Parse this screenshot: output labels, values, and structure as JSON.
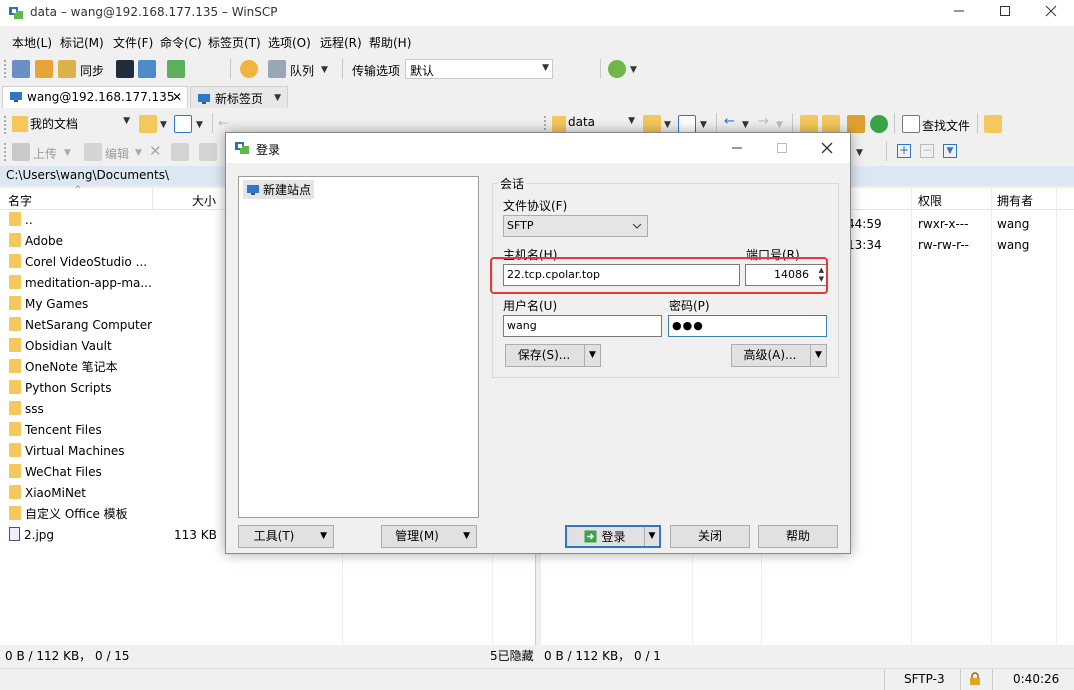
{
  "window": {
    "title": "data – wang@192.168.177.135 – WinSCP"
  },
  "menu": [
    "本地(L)",
    "标记(M)",
    "文件(F)",
    "命令(C)",
    "标签页(T)",
    "选项(O)",
    "远程(R)",
    "帮助(H)"
  ],
  "toolbar": {
    "sync_label": "同步",
    "queue_label": "队列",
    "transfer_options_label": "传输选项",
    "transfer_preset": "默认"
  },
  "tabs": [
    {
      "label": "wang@192.168.177.135"
    },
    {
      "label": "新标签页"
    }
  ],
  "local_panel": {
    "location": "我的文档",
    "upload_label": "上传",
    "edit_label": "编辑",
    "path": "C:\\Users\\wang\\Documents\\",
    "columns": {
      "name": "名字",
      "size": "大小"
    },
    "files": [
      {
        "name": "..",
        "size": "",
        "type": "parent"
      },
      {
        "name": "Adobe",
        "size": "",
        "type": "folder"
      },
      {
        "name": "Corel VideoStudio ...",
        "size": "",
        "type": "folder"
      },
      {
        "name": "meditation-app-ma...",
        "size": "",
        "type": "folder"
      },
      {
        "name": "My Games",
        "size": "",
        "type": "folder"
      },
      {
        "name": "NetSarang Computer",
        "size": "",
        "type": "folder"
      },
      {
        "name": "Obsidian Vault",
        "size": "",
        "type": "folder"
      },
      {
        "name": "OneNote 笔记本",
        "size": "",
        "type": "folder"
      },
      {
        "name": "Python Scripts",
        "size": "",
        "type": "folder"
      },
      {
        "name": "sss",
        "size": "",
        "type": "folder"
      },
      {
        "name": "Tencent Files",
        "size": "",
        "type": "folder"
      },
      {
        "name": "Virtual Machines",
        "size": "",
        "type": "folder"
      },
      {
        "name": "WeChat Files",
        "size": "",
        "type": "folder"
      },
      {
        "name": "XiaoMiNet",
        "size": "",
        "type": "folder"
      },
      {
        "name": "自定义 Office 模板",
        "size": "",
        "type": "folder"
      },
      {
        "name": "2.jpg",
        "size": "113 KB",
        "type": "file"
      }
    ],
    "status": "0 B / 112 KB，  0 / 15",
    "hidden": "5已隐藏"
  },
  "remote_panel": {
    "location": "data",
    "find_files_label": "查找文件",
    "columns": {
      "permissions": "权限",
      "owner": "拥有者"
    },
    "rows": [
      {
        "time": "44:59",
        "permissions": "rwxr-x---",
        "owner": "wang"
      },
      {
        "time": "13:34",
        "permissions": "rw-rw-r--",
        "owner": "wang"
      }
    ],
    "status": "0 B / 112 KB，  0 / 1"
  },
  "bottom_bar": {
    "protocol": "SFTP-3",
    "elapsed": "0:40:26"
  },
  "dialog": {
    "title": "登录",
    "site_tree": {
      "new_site": "新建站点"
    },
    "session_group": "会话",
    "protocol_label": "文件协议(F)",
    "protocol_value": "SFTP",
    "host_label": "主机名(H)",
    "host_value": "22.tcp.cpolar.top",
    "port_label": "端口号(R)",
    "port_value": "14086",
    "user_label": "用户名(U)",
    "user_value": "wang",
    "password_label": "密码(P)",
    "password_value": "●●●",
    "save_button": "保存(S)...",
    "advanced_button": "高级(A)...",
    "tools_button": "工具(T)",
    "manage_button": "管理(M)",
    "login_button": "登录",
    "close_button": "关闭",
    "help_button": "帮助"
  },
  "colors": {
    "highlight": "#e53935",
    "path_bar": "#dde7f3",
    "folder": "#f4c85c"
  }
}
